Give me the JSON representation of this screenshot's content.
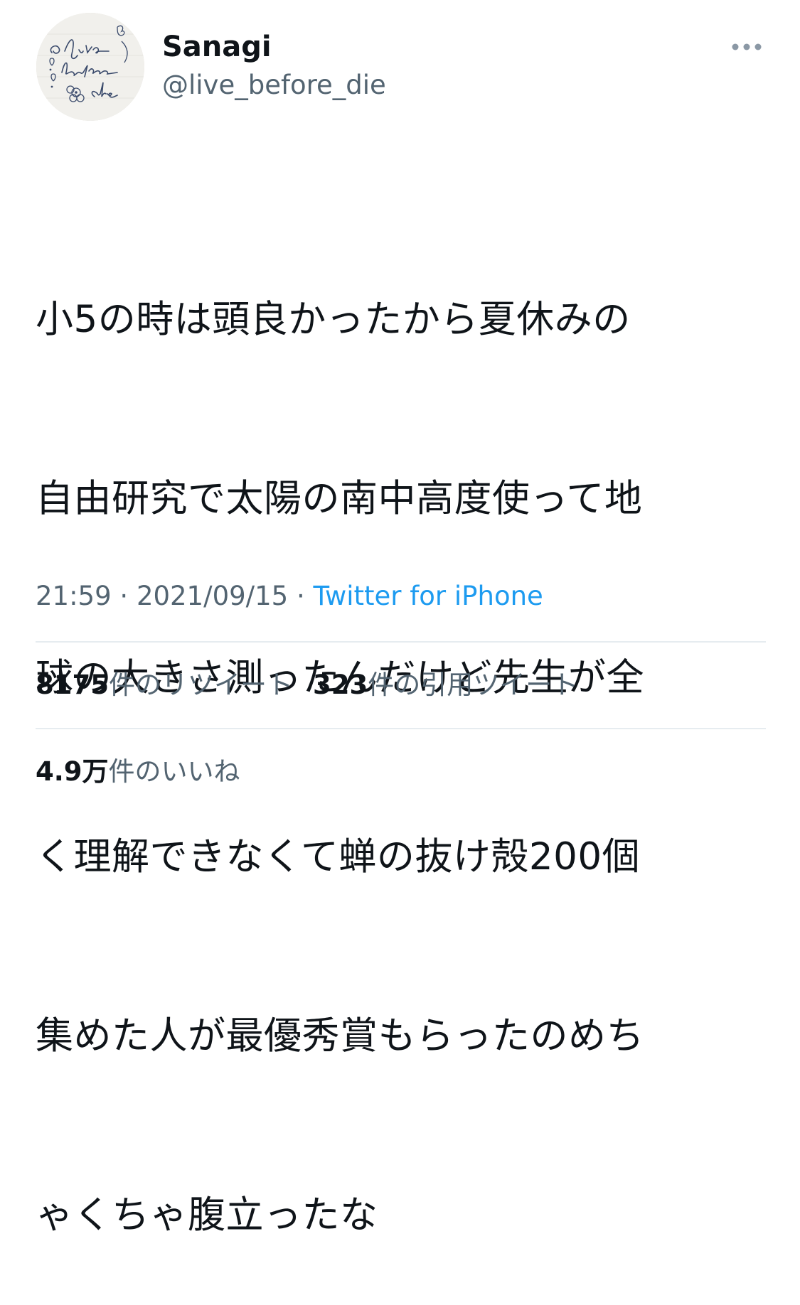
{
  "author": {
    "display_name": "Sanagi",
    "handle": "@live_before_die",
    "avatar_text": [
      "live",
      "before",
      "die"
    ]
  },
  "more_icon": "more-horizontal-icon",
  "tweet": {
    "lines": [
      "小5の時は頭良かったから夏休みの",
      "自由研究で太陽の南中高度使って地",
      "球の大きさ測ったんだけど先生が全",
      "く理解できなくて蝉の抜け殻200個",
      "集めた人が最優秀賞もらったのめち",
      "ゃくちゃ腹立ったな"
    ]
  },
  "meta": {
    "time": "21:59",
    "separator": " · ",
    "date": "2021/09/15",
    "source": "Twitter for iPhone"
  },
  "stats": {
    "retweets_count": "8175",
    "retweets_label": "件のリツイート",
    "quotes_count": "323",
    "quotes_label": "件の引用ツイート",
    "likes_count": "4.9万",
    "likes_label": "件のいいね"
  },
  "colors": {
    "text_primary": "#0f1419",
    "text_secondary": "#536471",
    "link": "#1d9bf0",
    "divider": "#e6ecf0"
  }
}
